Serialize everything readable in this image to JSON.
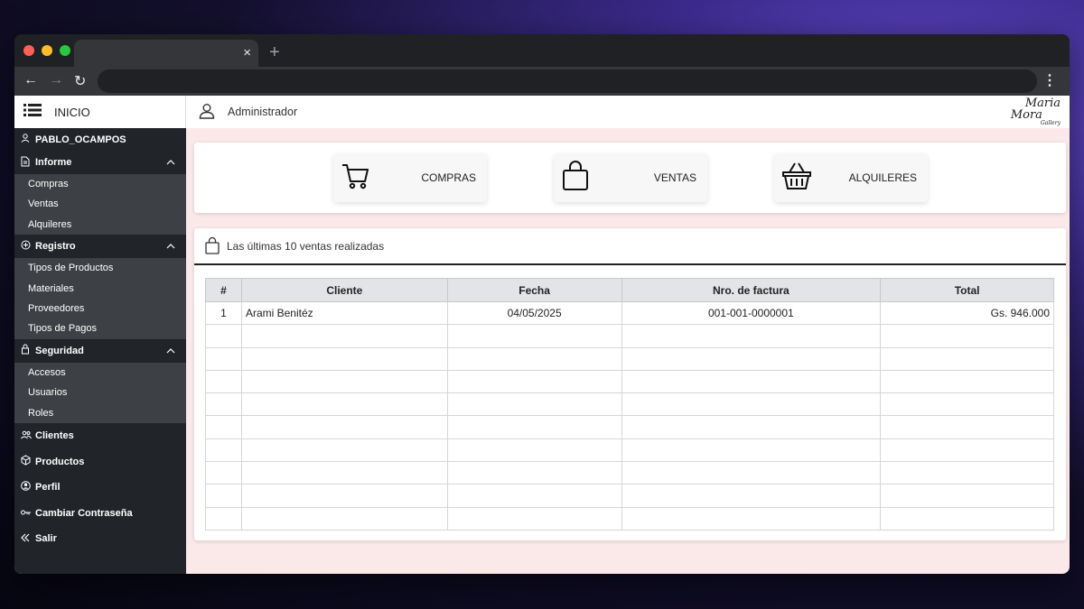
{
  "browser": {
    "tab_close": "×",
    "new_tab": "+",
    "back": "←",
    "forward": "→",
    "reload": "↻",
    "menu": "⋮"
  },
  "sidebar": {
    "brand_label": "INICIO",
    "username": "PABLO_OCAMPOS",
    "sections": {
      "informe": {
        "label": "Informe",
        "items": [
          "Compras",
          "Ventas",
          "Alquileres"
        ]
      },
      "registro": {
        "label": "Registro",
        "items": [
          "Tipos de Productos",
          "Materiales",
          "Proveedores",
          "Tipos de Pagos"
        ]
      },
      "seguridad": {
        "label": "Seguridad",
        "items": [
          "Accesos",
          "Usuarios",
          "Roles"
        ]
      }
    },
    "clientes": "Clientes",
    "productos": "Productos",
    "perfil": "Perfil",
    "cambiar": "Cambiar Contraseña",
    "salir": "Salir"
  },
  "topbar": {
    "user_label": "Administrador",
    "logo_top": "Maria",
    "logo_bottom": "Mora",
    "logo_sub": "Gallery"
  },
  "cards": {
    "compras": "COMPRAS",
    "ventas": "VENTAS",
    "alquileres": "ALQUILERES"
  },
  "panel": {
    "title": "Las últimas 10 ventas realizadas",
    "headers": [
      "#",
      "Cliente",
      "Fecha",
      "Nro. de factura",
      "Total"
    ],
    "rows": [
      [
        "1",
        "Arami Benitéz",
        "04/05/2025",
        "001-001-0000001",
        "Gs. 946.000"
      ]
    ]
  }
}
